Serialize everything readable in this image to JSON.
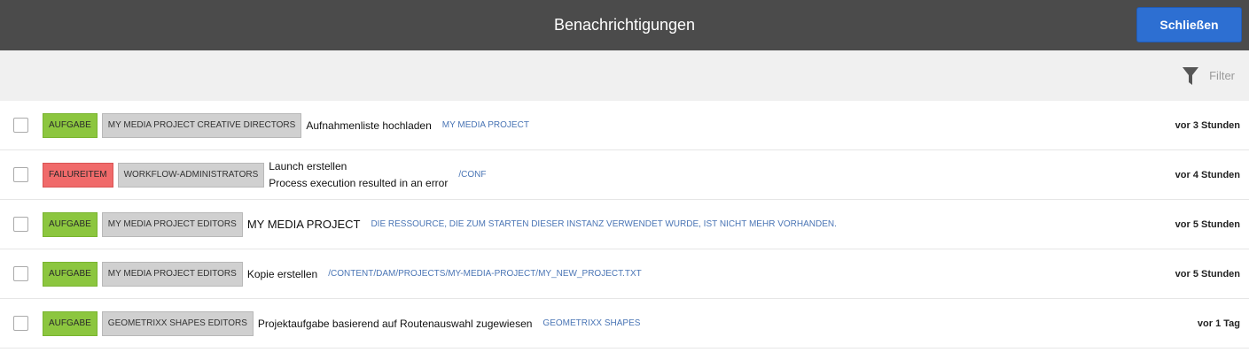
{
  "header": {
    "title": "Benachrichtigungen",
    "close_label": "Schließen"
  },
  "filter": {
    "label": "Filter",
    "icon": "funnel-icon"
  },
  "colors": {
    "header_bg": "#4b4b4b",
    "button_bg": "#2d6fd2",
    "aufgabe_tag": "#8cc63f",
    "failure_tag": "#f06a6a",
    "group_tag": "#d0d0d0",
    "link": "#4a75b5"
  },
  "notifications": [
    {
      "type": "AUFGABE",
      "group": "MY MEDIA PROJECT CREATIVE DIRECTORS",
      "message": "Aufnahmenliste hochladen",
      "link": "MY MEDIA PROJECT",
      "time": "vor 3 Stunden"
    },
    {
      "type": "FAILUREITEM",
      "group": "WORKFLOW-ADMINISTRATORS",
      "message_line1": "Launch erstellen",
      "message_line2": "Process execution resulted in an error",
      "link": "/CONF",
      "time": "vor 4 Stunden"
    },
    {
      "type": "AUFGABE",
      "group": "MY MEDIA PROJECT EDITORS",
      "message": "MY MEDIA PROJECT",
      "link": "DIE RESSOURCE, DIE ZUM STARTEN DIESER INSTANZ VERWENDET WURDE, IST NICHT MEHR VORHANDEN.",
      "time": "vor 5 Stunden"
    },
    {
      "type": "AUFGABE",
      "group": "MY MEDIA PROJECT EDITORS",
      "message": "Kopie erstellen",
      "link": "/CONTENT/DAM/PROJECTS/MY-MEDIA-PROJECT/MY_NEW_PROJECT.TXT",
      "time": "vor 5 Stunden"
    },
    {
      "type": "AUFGABE",
      "group": "GEOMETRIXX SHAPES EDITORS",
      "message": "Projektaufgabe basierend auf Routenauswahl zugewiesen",
      "link": "GEOMETRIXX SHAPES",
      "time": "vor 1 Tag"
    }
  ]
}
